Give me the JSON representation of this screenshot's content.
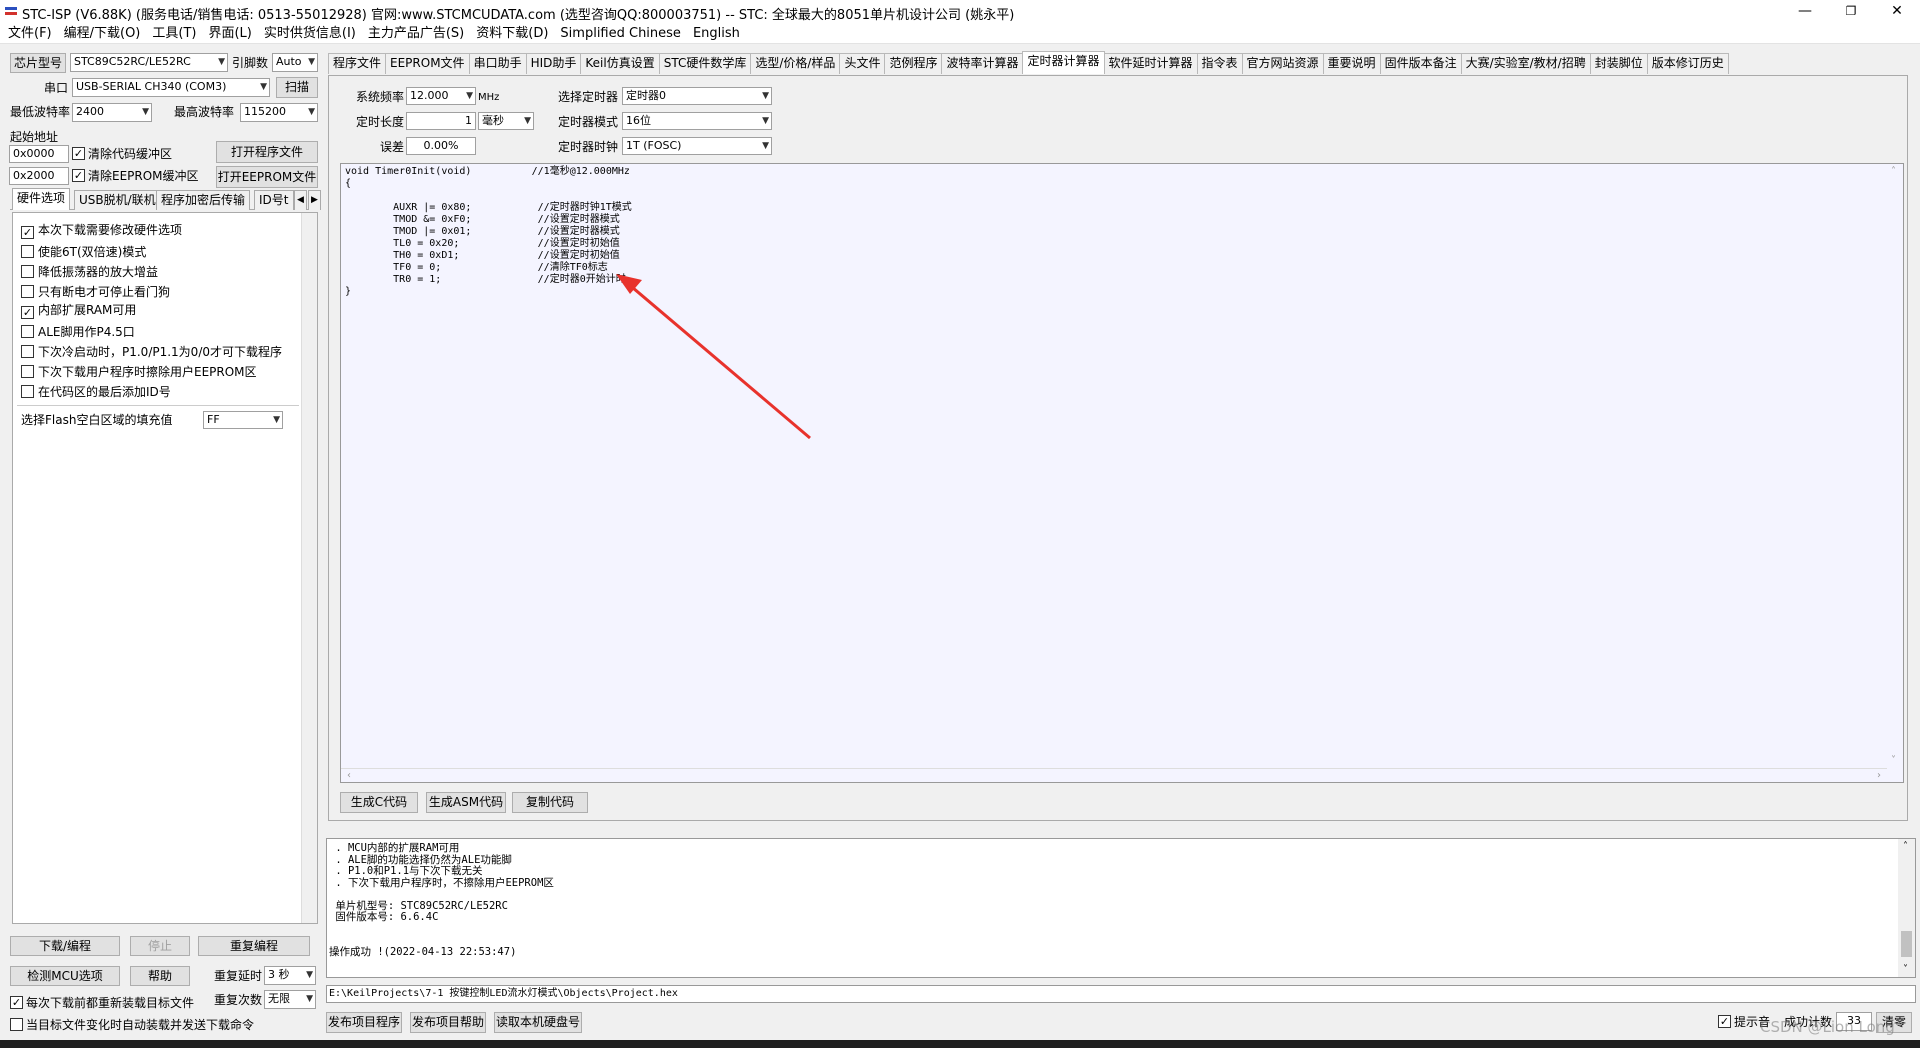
{
  "window": {
    "title": "STC-ISP (V6.88K) (服务电话/销售电话: 0513-55012928) 官网:www.STCMCUDATA.com  (选型咨询QQ:800003751) -- STC: 全球最大的8051单片机设计公司 (姚永平)",
    "minimize": "—",
    "restore": "❐",
    "close": "✕"
  },
  "menu": [
    "文件(F)",
    "编程/下载(O)",
    "工具(T)",
    "界面(L)",
    "实时供货信息(I)",
    "主力产品广告(S)",
    "资料下载(D)",
    "Simplified Chinese",
    "English"
  ],
  "left": {
    "chip_btn": "芯片型号",
    "chip_value": "STC89C52RC/LE52RC",
    "pin_label": "引脚数",
    "pin_value": "Auto",
    "port_label": "串口",
    "port_value": "USB-SERIAL CH340 (COM3)",
    "scan_btn": "扫描",
    "min_baud_label": "最低波特率",
    "min_baud_value": "2400",
    "max_baud_label": "最高波特率",
    "max_baud_value": "115200",
    "start_addr_label": "起始地址",
    "addr1": "0x0000",
    "clear_code_label": "清除代码缓冲区",
    "open_prog_btn": "打开程序文件",
    "addr2": "0x2000",
    "clear_eeprom_label": "清除EEPROM缓冲区",
    "open_eeprom_btn": "打开EEPROM文件",
    "tabs": [
      "硬件选项",
      "USB脱机/联机",
      "程序加密后传输",
      "ID号t"
    ],
    "options": [
      {
        "label": "本次下载需要修改硬件选项",
        "checked": "✓"
      },
      {
        "label": "使能6T(双倍速)模式",
        "checked": ""
      },
      {
        "label": "降低振荡器的放大增益",
        "checked": ""
      },
      {
        "label": "只有断电才可停止看门狗",
        "checked": ""
      },
      {
        "label": "内部扩展RAM可用",
        "checked": "✓"
      },
      {
        "label": "ALE脚用作P4.5口",
        "checked": ""
      },
      {
        "label": "下次冷启动时，P1.0/P1.1为0/0才可下载程序",
        "checked": ""
      },
      {
        "label": "下次下载用户程序时擦除用户EEPROM区",
        "checked": ""
      },
      {
        "label": "在代码区的最后添加ID号",
        "checked": ""
      }
    ],
    "flash_fill_label": "选择Flash空白区域的填充值",
    "flash_fill_value": "FF",
    "download_btn": "下载/编程",
    "stop_btn": "停止",
    "reprogram_btn": "重复编程",
    "check_mcu_btn": "检测MCU选项",
    "help_btn": "帮助",
    "repeat_delay_label": "重复延时",
    "repeat_delay_value": "3 秒",
    "repeat_count_label": "重复次数",
    "repeat_count_value": "无限",
    "reload_label": "每次下载前都重新装载目标文件",
    "auto_send_label": "当目标文件变化时自动装载并发送下载命令"
  },
  "tabs_main": [
    "程序文件",
    "EEPROM文件",
    "串口助手",
    "HID助手",
    "Keil仿真设置",
    "STC硬件数学库",
    "选型/价格/样品",
    "头文件",
    "范例程序",
    "波特率计算器",
    "定时器计算器",
    "软件延时计算器",
    "指令表",
    "官方网站资源",
    "重要说明",
    "固件版本备注",
    "大赛/实验室/教材/招聘",
    "封装脚位",
    "版本修订历史"
  ],
  "timer": {
    "sysfreq_label": "系统频率",
    "sysfreq_value": "12.000",
    "sysfreq_unit": "MHz",
    "select_timer_label": "选择定时器",
    "select_timer_value": "定时器0",
    "length_label": "定时长度",
    "length_value": "1",
    "length_unit": "毫秒",
    "mode_label": "定时器模式",
    "mode_value": "16位",
    "error_label": "误差",
    "error_value": "0.00%",
    "clock_label": "定时器时钟",
    "clock_value": "1T  (FOSC)",
    "gen_c_btn": "生成C代码",
    "gen_asm_btn": "生成ASM代码",
    "copy_btn": "复制代码"
  },
  "code": "void Timer0Init(void)          //1毫秒@12.000MHz\n{\n\n        AUXR |= 0x80;           //定时器时钟1T模式\n        TMOD &= 0xF0;           //设置定时器模式\n        TMOD |= 0x01;           //设置定时器模式\n        TL0 = 0x20;             //设置定时初始值\n        TH0 = 0xD1;             //设置定时初始值\n        TF0 = 0;                //清除TF0标志\n        TR0 = 1;                //定时器0开始计时\n}",
  "log": " . MCU内部的扩展RAM可用\n . ALE脚的功能选择仍然为ALE功能脚\n . P1.0和P1.1与下次下载无关\n . 下次下载用户程序时，不擦除用户EEPROM区\n\n 单片机型号: STC89C52RC/LE52RC\n 固件版本号: 6.6.4C\n\n\n操作成功 !(2022-04-13 22:53:47)",
  "path": "E:\\KeilProjects\\7-1 按键控制LED流水灯模式\\Objects\\Project.hex",
  "bottom": {
    "publish_btn": "发布项目程序",
    "publish_help_btn": "发布项目帮助",
    "read_disk_btn": "读取本机硬盘号",
    "tone_label": "提示音",
    "success_label": "成功计数",
    "success_value": "33",
    "clear_btn": "清零",
    "watermark": "CSDN @Lion Long"
  },
  "colors": {
    "arrow": "#e8322c",
    "code_bg": "#f4f4ff"
  }
}
